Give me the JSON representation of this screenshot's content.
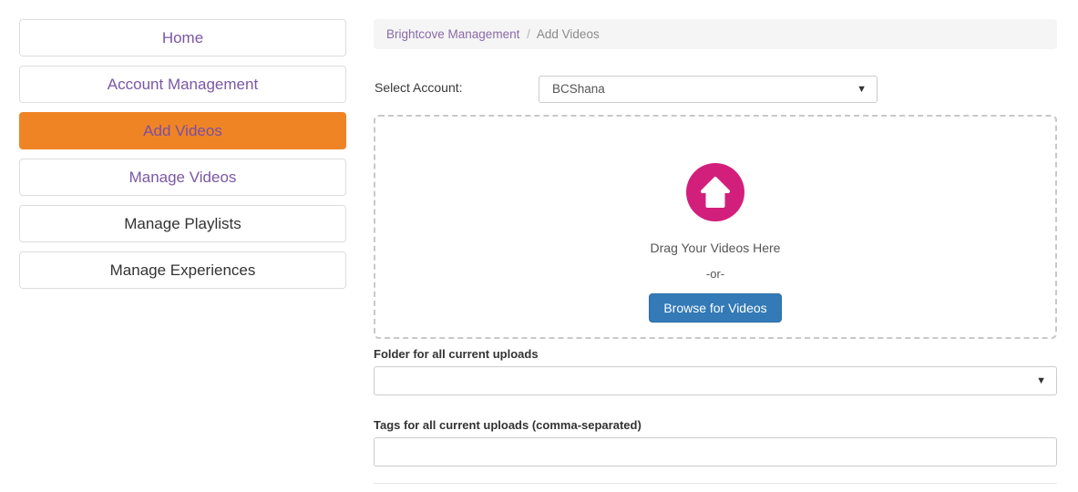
{
  "sidebar": {
    "items": [
      {
        "label": "Home",
        "state": "link"
      },
      {
        "label": "Account Management",
        "state": "link"
      },
      {
        "label": "Add Videos",
        "state": "active"
      },
      {
        "label": "Manage Videos",
        "state": "link"
      },
      {
        "label": "Manage Playlists",
        "state": "muted"
      },
      {
        "label": "Manage Experiences",
        "state": "muted"
      }
    ]
  },
  "breadcrumb": {
    "parent": "Brightcove Management",
    "separator": "/",
    "current": "Add Videos"
  },
  "account": {
    "label": "Select Account:",
    "selected": "BCShana",
    "caret": "▼"
  },
  "dropzone": {
    "icon": "upload-arrow-icon",
    "drag_text": "Drag Your Videos Here",
    "or_text": "-or-",
    "browse_label": "Browse for Videos"
  },
  "folder_field": {
    "label": "Folder for all current uploads",
    "value": "",
    "caret": "▼"
  },
  "tags_field": {
    "label": "Tags for all current uploads (comma-separated)",
    "value": "",
    "placeholder": ""
  },
  "colors": {
    "active_nav": "#ef8425",
    "nav_link": "#7a57a5",
    "upload_circle": "#d31f7c",
    "primary_button": "#337ab7",
    "breadcrumb_bg": "#f5f5f5"
  }
}
